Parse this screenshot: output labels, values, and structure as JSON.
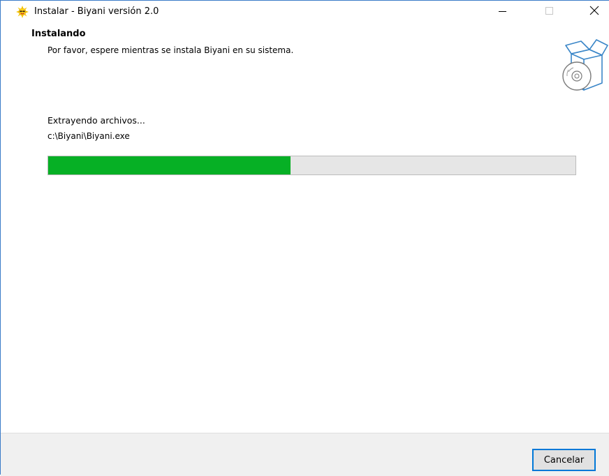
{
  "window": {
    "title": "Instalar - Biyani versión 2.0",
    "controls": {
      "minimize_icon": "minimize-icon",
      "maximize_icon": "maximize-icon",
      "close_icon": "close-icon"
    }
  },
  "header": {
    "title": "Instalando",
    "subtitle": "Por favor, espere mientras se instala Biyani en su sistema."
  },
  "main": {
    "status": "Extrayendo archivos...",
    "current_file": "c:\\Biyani\\Biyani.exe",
    "progress_fraction": 0.46
  },
  "footer": {
    "cancel_label": "Cancelar"
  },
  "colors": {
    "progress_fill": "#06b025",
    "progress_track": "#e6e6e6",
    "accent_border": "#0078d7",
    "window_border": "#3a7bc8"
  }
}
